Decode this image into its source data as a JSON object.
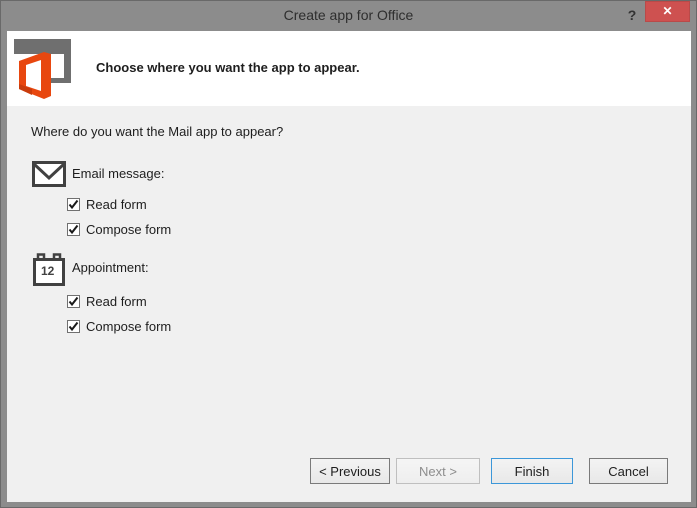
{
  "window": {
    "title": "Create app for Office",
    "help_label": "?",
    "close_label": "x"
  },
  "header": {
    "instruction": "Choose where you want the app to appear."
  },
  "body": {
    "question": "Where do you want the Mail app to appear?",
    "sections": [
      {
        "icon": "email-message-icon",
        "label": "Email message:",
        "options": [
          {
            "label": "Read form",
            "checked": true
          },
          {
            "label": "Compose form",
            "checked": true
          }
        ]
      },
      {
        "icon": "appointment-calendar-icon",
        "icon_day": "12",
        "label": "Appointment:",
        "options": [
          {
            "label": "Read form",
            "checked": true
          },
          {
            "label": "Compose form",
            "checked": true
          }
        ]
      }
    ]
  },
  "footer": {
    "buttons": [
      {
        "label": "< Previous",
        "state": "enabled"
      },
      {
        "label": "Next >",
        "state": "disabled"
      },
      {
        "label": "Finish",
        "state": "default"
      },
      {
        "label": "Cancel",
        "state": "enabled"
      }
    ]
  },
  "colors": {
    "frame_gray": "#8c8c8c",
    "body_gray": "#f0f0f0",
    "close_red": "#ce5150",
    "office_orange": "#e8470f",
    "logo_gray": "#6f6f6f",
    "icon_gray": "#414141",
    "default_button_blue": "#3c97d9"
  }
}
